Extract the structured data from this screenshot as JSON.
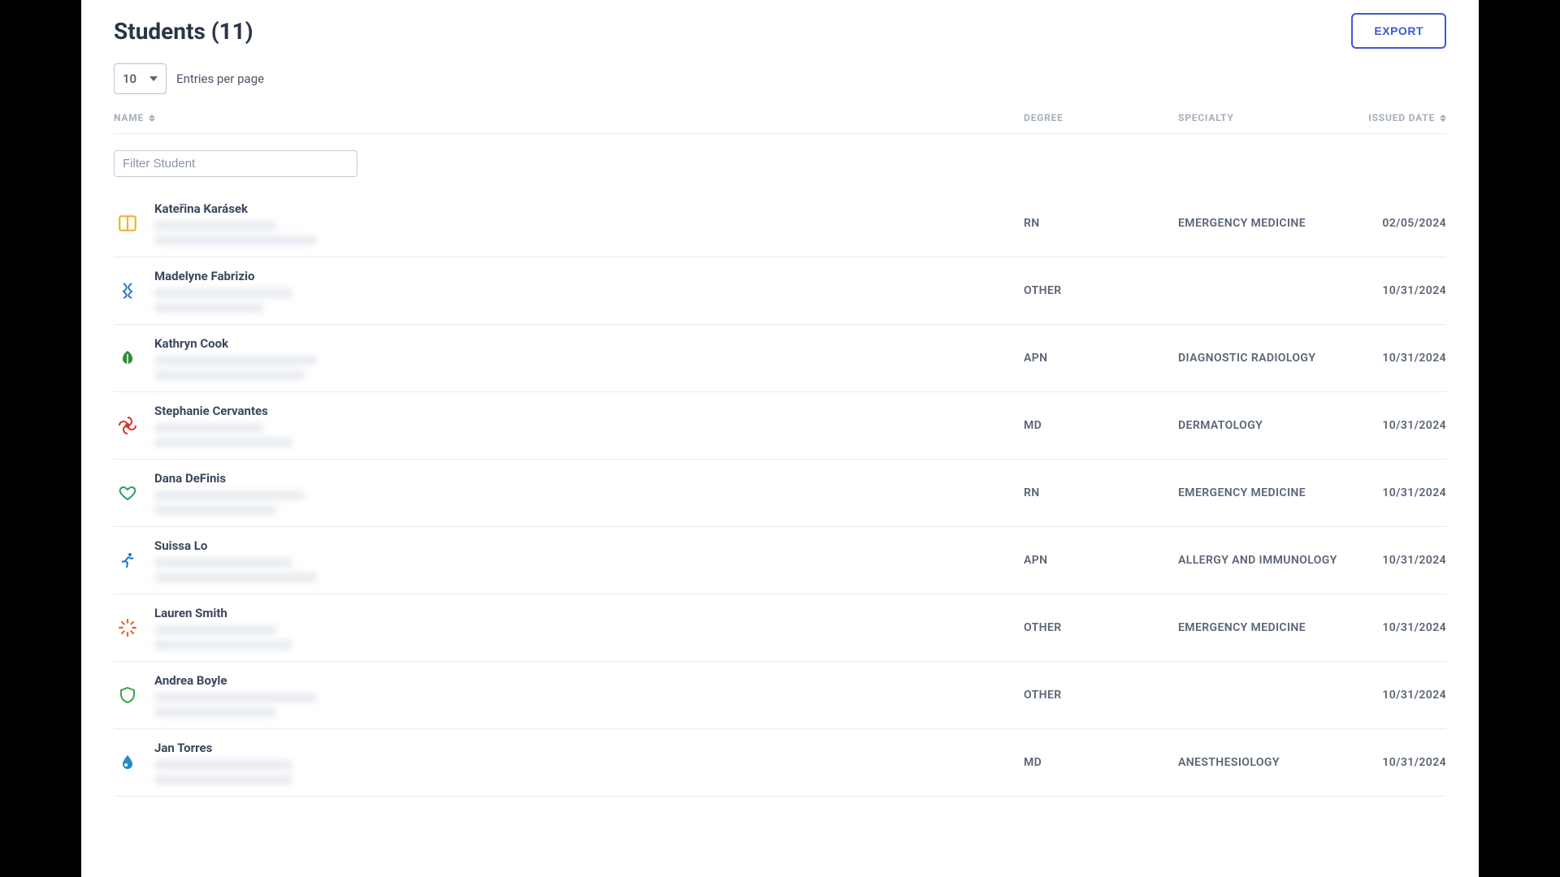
{
  "header": {
    "title": "Students (11)",
    "export_label": "EXPORT"
  },
  "controls": {
    "per_page_value": "10",
    "per_page_label": "Entries per page"
  },
  "columns": {
    "name": "NAME",
    "degree": "DEGREE",
    "specialty": "SPECIALTY",
    "issued": "ISSUED DATE"
  },
  "filter": {
    "placeholder": "Filter Student",
    "value": ""
  },
  "rows": [
    {
      "name": "Kateřina Karásek",
      "degree": "RN",
      "specialty": "EMERGENCY MEDICINE",
      "issued": "02/05/2024",
      "icon": "book",
      "color": "#f3b124"
    },
    {
      "name": "Madelyne Fabrizio",
      "degree": "OTHER",
      "specialty": "",
      "issued": "10/31/2024",
      "icon": "dna",
      "color": "#2374c6"
    },
    {
      "name": "Kathryn Cook",
      "degree": "APN",
      "specialty": "DIAGNOSTIC RADIOLOGY",
      "issued": "10/31/2024",
      "icon": "leaf",
      "color": "#2e8d3d"
    },
    {
      "name": "Stephanie Cervantes",
      "degree": "MD",
      "specialty": "DERMATOLOGY",
      "issued": "10/31/2024",
      "icon": "fan",
      "color": "#d6362e"
    },
    {
      "name": "Dana DeFinis",
      "degree": "RN",
      "specialty": "EMERGENCY MEDICINE",
      "issued": "10/31/2024",
      "icon": "heart",
      "color": "#2aa25a"
    },
    {
      "name": "Suissa Lo",
      "degree": "APN",
      "specialty": "ALLERGY AND IMMUNOLOGY",
      "issued": "10/31/2024",
      "icon": "run",
      "color": "#2374c6"
    },
    {
      "name": "Lauren Smith",
      "degree": "OTHER",
      "specialty": "EMERGENCY MEDICINE",
      "issued": "10/31/2024",
      "icon": "spark",
      "color": "#e8642f"
    },
    {
      "name": "Andrea Boyle",
      "degree": "OTHER",
      "specialty": "",
      "issued": "10/31/2024",
      "icon": "shield",
      "color": "#3aa64a"
    },
    {
      "name": "Jan Torres",
      "degree": "MD",
      "specialty": "ANESTHESIOLOGY",
      "issued": "10/31/2024",
      "icon": "drop",
      "color": "#1f8cc8"
    }
  ]
}
